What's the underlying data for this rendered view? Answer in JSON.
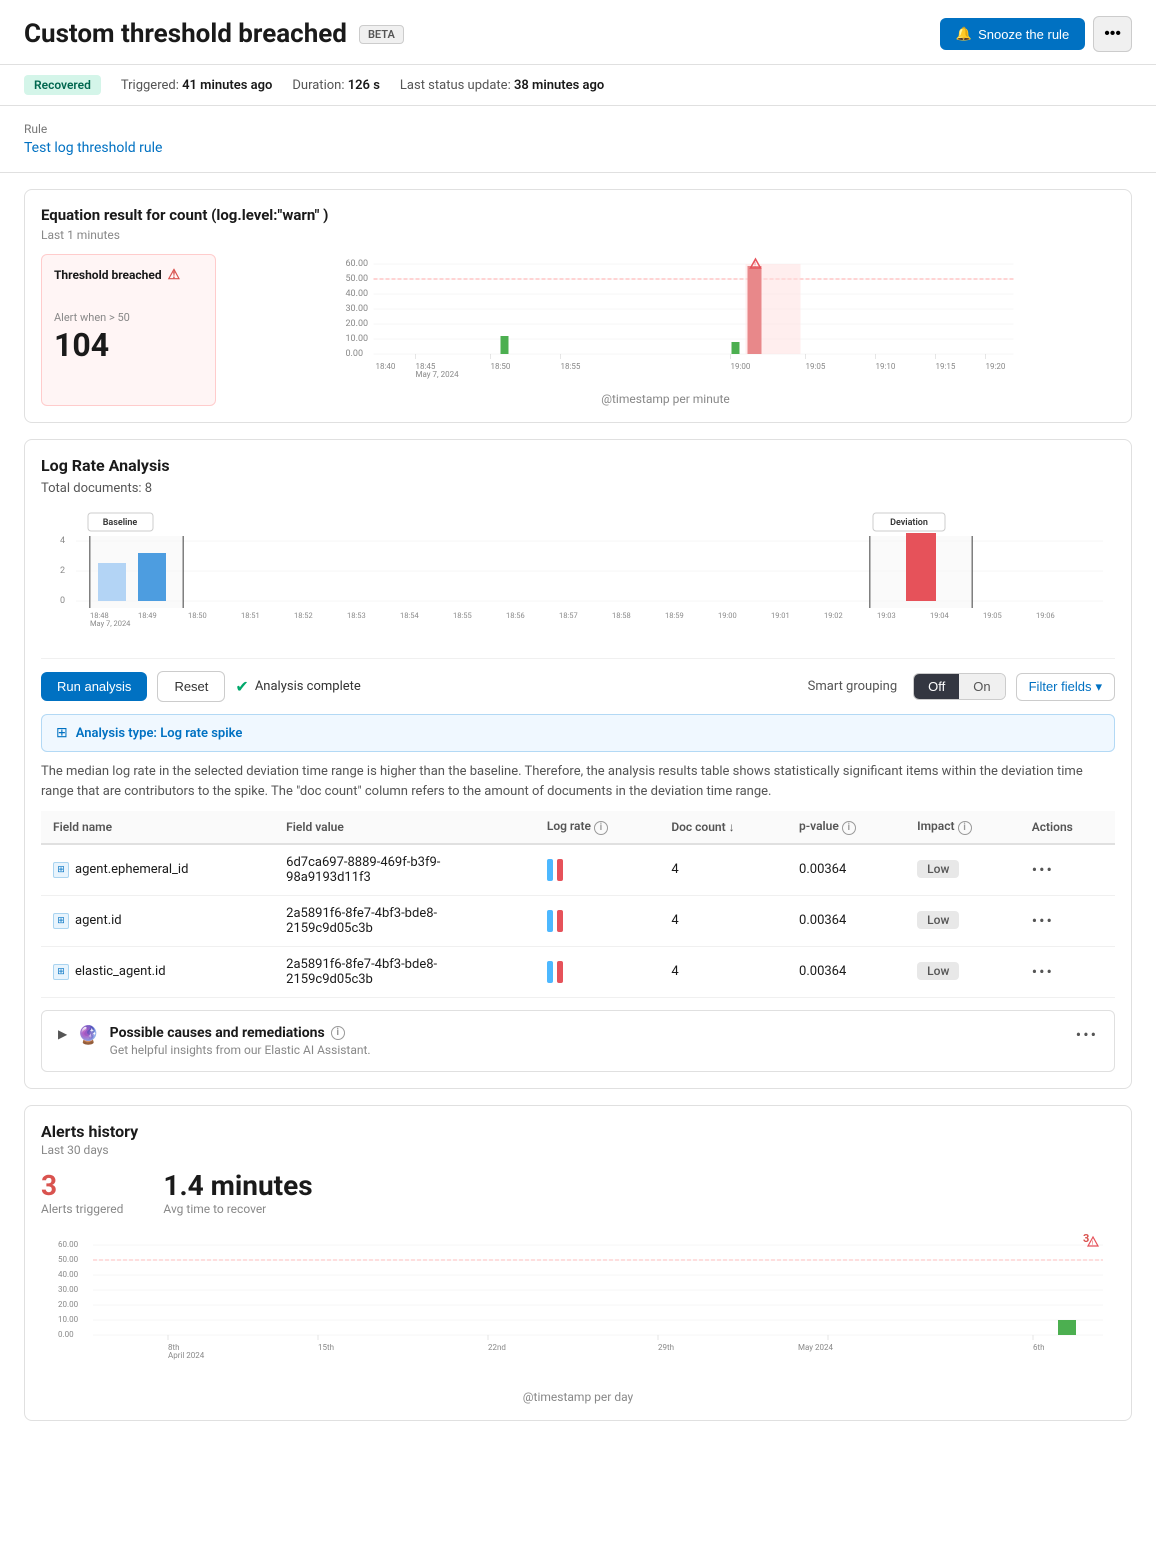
{
  "header": {
    "title": "Custom threshold breached",
    "beta_label": "BETA",
    "snooze_label": "Snooze the rule",
    "more_label": "•••"
  },
  "status": {
    "badge": "Recovered",
    "triggered_label": "Triggered:",
    "triggered_value": "41 minutes ago",
    "duration_label": "Duration:",
    "duration_value": "126 s",
    "last_update_label": "Last status update:",
    "last_update_value": "38 minutes ago"
  },
  "rule": {
    "label": "Rule",
    "link_text": "Test log threshold rule"
  },
  "equation_chart": {
    "title": "Equation result for count (log.level:\"warn\" )",
    "subtitle": "Last 1 minutes",
    "threshold_box": {
      "title": "Threshold breached",
      "alert_text": "Alert when > 50",
      "value": "104"
    },
    "x_axis_label": "@timestamp per minute",
    "y_axis": [
      "60.00",
      "50.00",
      "40.00",
      "30.00",
      "20.00",
      "10.00",
      "0.00"
    ],
    "x_labels": [
      "18:40",
      "18:45 May 7, 2024",
      "18:50",
      "18:55",
      "19:00",
      "19:05",
      "19:10",
      "19:15",
      "19:20"
    ]
  },
  "log_rate": {
    "title": "Log Rate Analysis",
    "total_docs": "Total documents: 8",
    "baseline_label": "Baseline",
    "deviation_label": "Deviation",
    "x_labels": [
      "18:48 May 7, 2024",
      "18:49",
      "18:50",
      "18:51",
      "18:52",
      "18:53",
      "18:54",
      "18:55",
      "18:56",
      "18:57",
      "18:58",
      "18:59",
      "19:00",
      "19:01",
      "19:02",
      "19:03",
      "19:04",
      "19:05",
      "19:06"
    ],
    "y_axis": [
      "4",
      "2",
      "0"
    ],
    "run_analysis_label": "Run analysis",
    "reset_label": "Reset",
    "analysis_complete_label": "Analysis complete",
    "smart_grouping_label": "Smart grouping",
    "toggle_off": "Off",
    "toggle_on": "On",
    "filter_fields_label": "Filter fields",
    "analysis_type_label": "Analysis type: Log rate spike",
    "analysis_description": "The median log rate in the selected deviation time range is higher than the baseline. Therefore, the analysis results table shows statistically significant items within the deviation time range that are contributors to the spike. The \"doc count\" column refers to the amount of documents in the deviation time range.",
    "table": {
      "headers": [
        "Field name",
        "Field value",
        "Log rate",
        "Doc count",
        "p-value",
        "Impact",
        "Actions"
      ],
      "rows": [
        {
          "field_name": "agent.ephemeral_id",
          "field_value": "6d7ca697-8889-469f-b3f9-98a9193d11f3",
          "log_rate": "bars",
          "doc_count": "4",
          "p_value": "0.00364",
          "impact": "Low",
          "actions": "•••"
        },
        {
          "field_name": "agent.id",
          "field_value": "2a5891f6-8fe7-4bf3-bde8-2159c9d05c3b",
          "log_rate": "bars",
          "doc_count": "4",
          "p_value": "0.00364",
          "impact": "Low",
          "actions": "•••"
        },
        {
          "field_name": "elastic_agent.id",
          "field_value": "2a5891f6-8fe7-4bf3-bde8-2159c9d05c3b",
          "log_rate": "bars",
          "doc_count": "4",
          "p_value": "0.00364",
          "impact": "Low",
          "actions": "•••"
        }
      ]
    }
  },
  "possible_causes": {
    "title": "Possible causes and remediations",
    "subtitle": "Get helpful insights from our Elastic AI Assistant.",
    "more_label": "•••"
  },
  "alerts_history": {
    "title": "Alerts history",
    "subtitle": "Last 30 days",
    "alerts_triggered_count": "3",
    "alerts_triggered_label": "Alerts triggered",
    "avg_time": "1.4 minutes",
    "avg_time_label": "Avg time to recover",
    "x_axis_label": "@timestamp per day",
    "x_labels": [
      "8th April 2024",
      "15th",
      "22nd",
      "29th",
      "May 2024",
      "6th"
    ],
    "y_axis": [
      "60.00",
      "50.00",
      "40.00",
      "30.00",
      "20.00",
      "10.00",
      "0.00"
    ]
  }
}
